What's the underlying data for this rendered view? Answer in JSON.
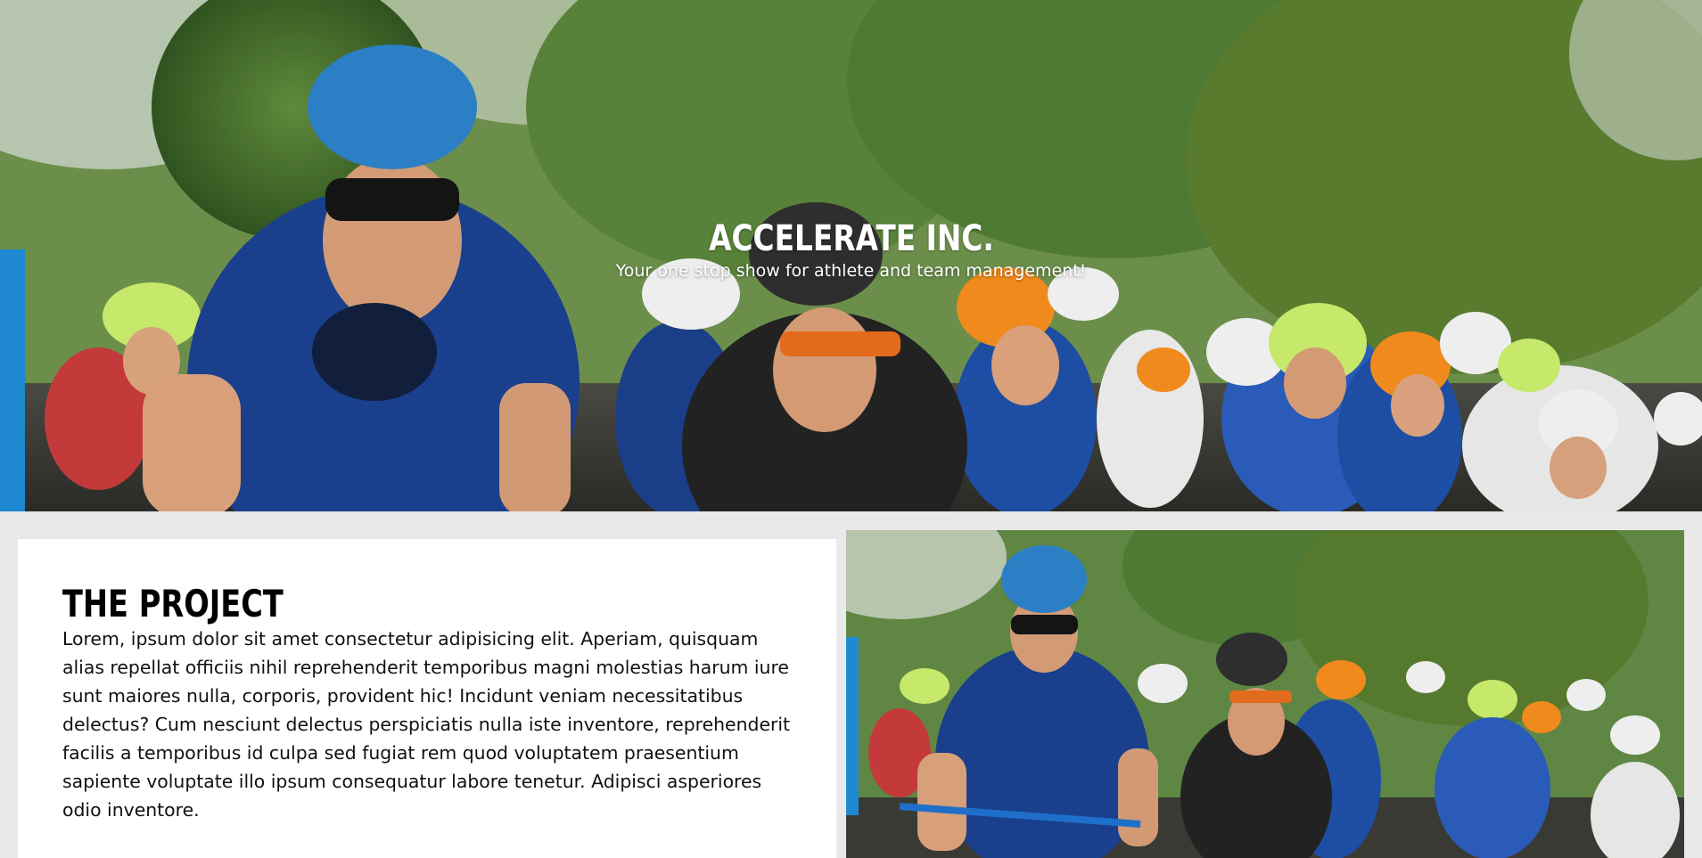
{
  "hero": {
    "title": "ACCELERATE INC.",
    "subtitle": "Your one stop show for athlete and team management!"
  },
  "project": {
    "title": "THE PROJECT",
    "body": "Lorem, ipsum dolor sit amet consectetur adipisicing elit. Aperiam, quisquam alias repellat officiis nihil reprehenderit temporibus magni molestias harum iure sunt maiores nulla, corporis, provident hic! Incidunt veniam necessitatibus delectus? Cum nesciunt delectus perspiciatis nulla iste inventore, reprehenderit facilis a temporibus id culpa sed fugiat rem quod voluptatem praesentium sapiente voluptate illo ipsum consequatur labore tenetur. Adipisci asperiores odio inventore."
  },
  "colors": {
    "page_background": "#e9e9e9",
    "card_background": "#ffffff",
    "hero_text": "#ffffff",
    "jersey_blue": "#1a3f8c",
    "jersey_black": "#222222",
    "helmet_green": "#c6e86b",
    "helmet_orange": "#f08a1c",
    "helmet_white": "#eeeeee"
  }
}
